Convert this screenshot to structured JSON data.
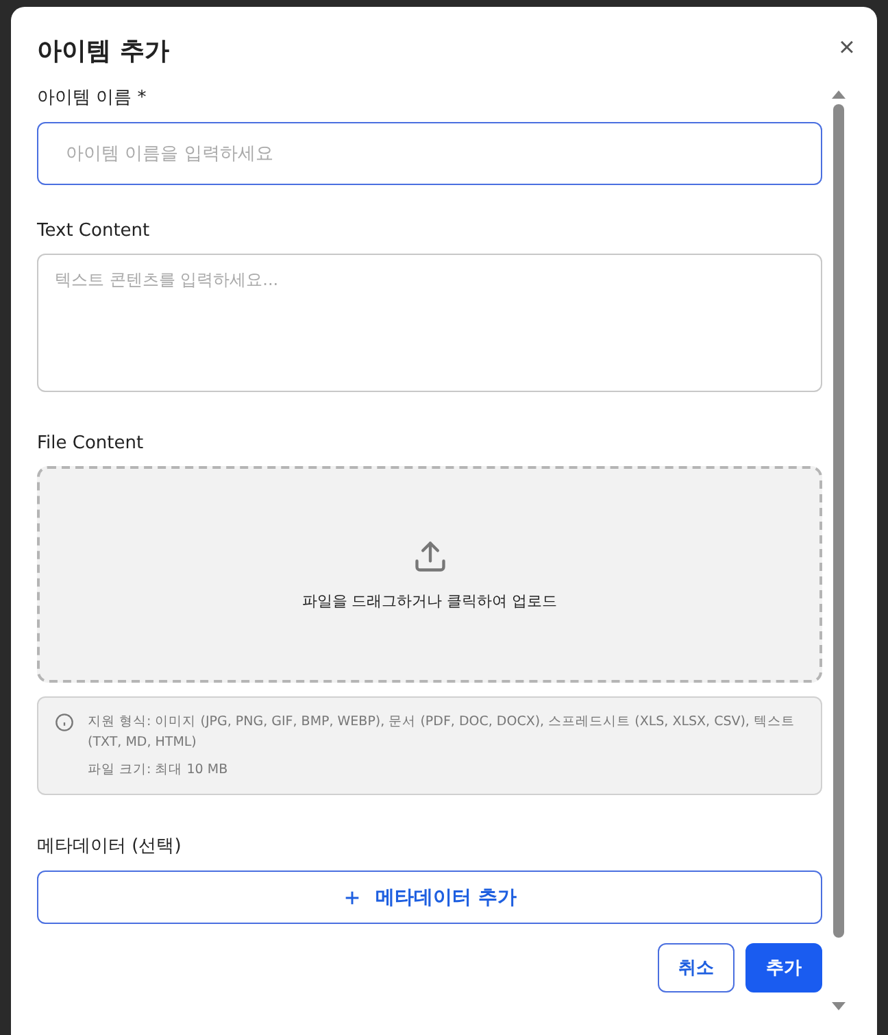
{
  "dialog": {
    "title": "아이템 추가",
    "close": "×"
  },
  "fields": [
    {
      "kind": "input",
      "label": "아이템 이름 *",
      "placeholder": "아이템 이름을 입력하세요",
      "focused": true
    },
    {
      "kind": "textarea",
      "label": "Text Content",
      "placeholder": "텍스트 콘텐츠를 입력하세요...",
      "focused": false
    },
    {
      "kind": "upload",
      "label": "File Content",
      "prompt": "파일을 드래그하거나 클릭하여 업로드"
    }
  ],
  "info": {
    "formats": "지원 형식: 이미지 (JPG, PNG, GIF, BMP, WEBP), 문서 (PDF, DOC, DOCX), 스프레드시트 (XLS, XLSX, CSV), 텍스트 (TXT, MD, HTML)",
    "size": "파일 크기: 최대 10 MB"
  },
  "metadata": {
    "label": "메타데이터 (선택)",
    "add_button": "메타데이터 추가"
  },
  "buttons": [
    {
      "label": "취소",
      "kind": "secondary"
    },
    {
      "label": "추가",
      "kind": "primary"
    }
  ]
}
